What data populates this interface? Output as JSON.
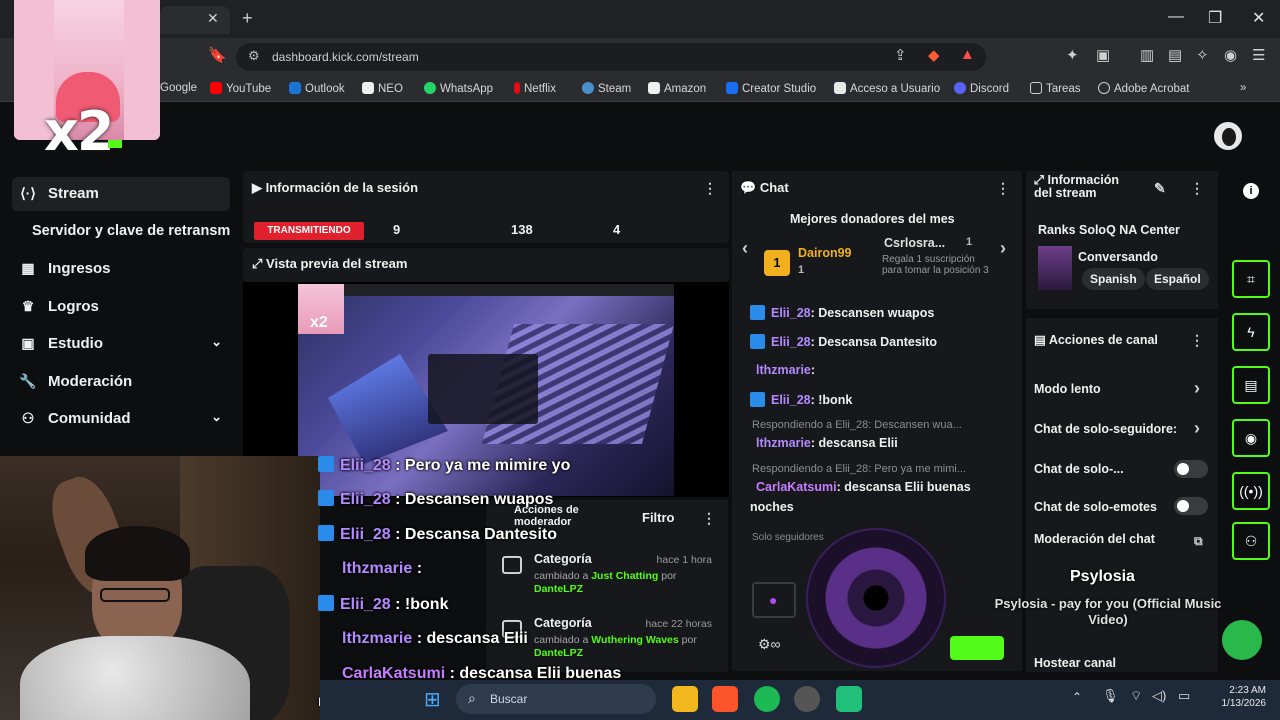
{
  "browser": {
    "url": "dashboard.kick.com/stream",
    "bookmarks": [
      "Google",
      "YouTube",
      "Outlook",
      "NEO",
      "WhatsApp",
      "Netflix",
      "Steam",
      "Amazon",
      "Creator Studio",
      "Acceso a Usuario",
      "Discord",
      "Tareas",
      "Adobe Acrobat"
    ]
  },
  "overlay": {
    "multiplier": "x2"
  },
  "sidebar": {
    "items": [
      {
        "label": "Stream",
        "icon": "broadcast-icon"
      },
      {
        "label": "Servidor y clave de retransm"
      },
      {
        "label": "Ingresos",
        "icon": "chart-icon"
      },
      {
        "label": "Logros",
        "icon": "trophy-icon"
      },
      {
        "label": "Estudio",
        "icon": "studio-icon"
      },
      {
        "label": "Moderación",
        "icon": "wrench-icon"
      },
      {
        "label": "Comunidad",
        "icon": "community-icon"
      }
    ]
  },
  "session": {
    "title": "Información de la sesión",
    "live_label": "TRANSMITIENDO",
    "stats": [
      "9",
      "138",
      "4"
    ]
  },
  "preview": {
    "title": "Vista previa del stream"
  },
  "overlay_chat": [
    {
      "user": "Elii_28",
      "text": "Pero ya me mimire yo"
    },
    {
      "user": "Elii_28",
      "text": "Descansen wuapos"
    },
    {
      "user": "Elii_28",
      "text": "Descansa Dantesito"
    },
    {
      "user": "lthzmarie",
      "text": ""
    },
    {
      "user": "Elii_28",
      "text": "!bonk"
    },
    {
      "user": "lthzmarie",
      "text": "descansa Elii"
    },
    {
      "user": "CarlaKatsumi",
      "text": "descansa Elii buenas"
    },
    {
      "user": "",
      "text": "noches"
    }
  ],
  "activity": {
    "filter_label": "Filtro",
    "mod_actions_label": "Acciones de moderador",
    "items": [
      {
        "title": "Categoría",
        "time": "hace 1 hora",
        "prefix": "cambiado a",
        "value": "Just Chatting",
        "by": "por",
        "user": "DanteLPZ"
      },
      {
        "title": "Categoría",
        "time": "hace 22 horas",
        "prefix": "cambiado a",
        "value": "Wuthering Waves",
        "by": "por",
        "user": "DanteLPZ"
      }
    ]
  },
  "chat": {
    "title": "Chat",
    "top_donors_title": "Mejores donadores del mes",
    "donor1": {
      "name": "Dairon99",
      "rank": "1"
    },
    "donor2": {
      "name": "Csrlosra...",
      "rank": "1"
    },
    "gift_text": "Regala 1 suscripción para tomar la posición 3",
    "messages": [
      {
        "user": "Elii_28",
        "text": ": Descansen wuapos"
      },
      {
        "user": "Elii_28",
        "text": ": Descansa Dantesito"
      },
      {
        "user": "lthzmarie",
        "text": ":"
      },
      {
        "user": "Elii_28",
        "text": ": !bonk"
      }
    ],
    "reply1": "Respondiendo a Elii_28: Descansen wua...",
    "reply1_msg_user": "lthzmarie",
    "reply1_msg_text": ": descansa Elii",
    "reply2": "Respondiendo a Elii_28: Pero ya me mimi...",
    "reply2_msg_user": "CarlaKatsumi",
    "reply2_msg_text": ": descansa Elii buenas",
    "reply2_msg_text2": "noches",
    "followers_only_note": "Solo seguidores"
  },
  "info": {
    "title": "Información del stream",
    "stream_title": "Ranks SoloQ NA Center",
    "category": "Conversando",
    "tags": [
      "Spanish",
      "Español"
    ]
  },
  "actions": {
    "title": "Acciones de canal",
    "items": [
      {
        "label": "Modo lento",
        "control": "chevron"
      },
      {
        "label": "Chat de solo-seguidore:",
        "control": "chevron"
      },
      {
        "label": "Chat de solo-...",
        "control": "toggle"
      },
      {
        "label": "Chat de solo-emotes",
        "control": "toggle"
      },
      {
        "label": "Moderación del chat",
        "control": "link"
      },
      {
        "label": "Hostear canal",
        "control": "none"
      }
    ]
  },
  "music": {
    "artist": "Psylosia",
    "title": "Psylosia - pay for you (Official Music Video)"
  },
  "taskbar": {
    "search_placeholder": "Buscar",
    "time": "2:23 AM",
    "date": "1/13/2026"
  },
  "colors": {
    "accent": "#53fc18",
    "live": "#e0202d",
    "username": "#b48aff",
    "badge": "#2a8be8"
  }
}
